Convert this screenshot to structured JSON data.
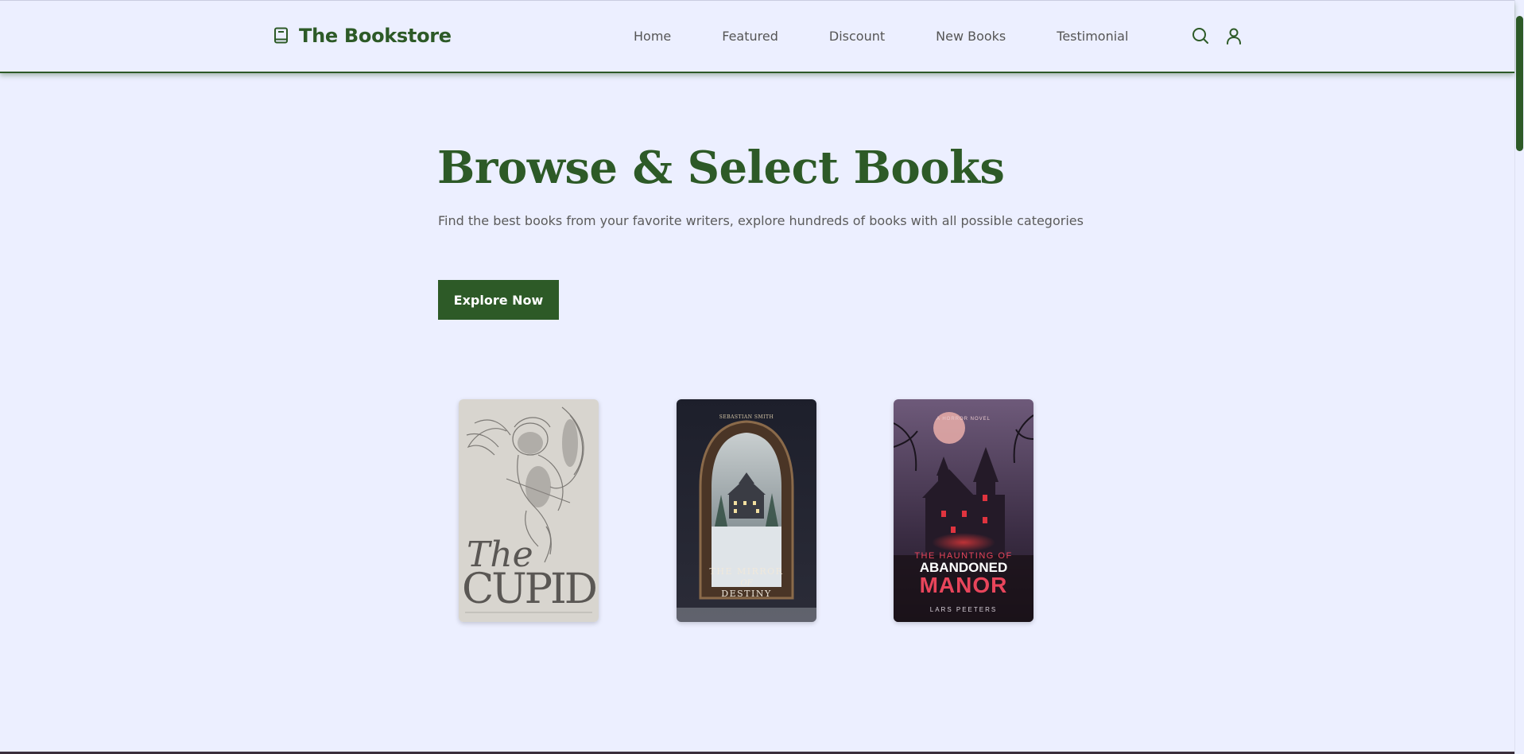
{
  "header": {
    "logo_text": "The Bookstore",
    "nav": [
      {
        "label": "Home"
      },
      {
        "label": "Featured"
      },
      {
        "label": "Discount"
      },
      {
        "label": "New Books"
      },
      {
        "label": "Testimonial"
      }
    ],
    "icons": [
      "book-icon",
      "search-icon",
      "user-icon"
    ]
  },
  "hero": {
    "title": "Browse & Select Books",
    "subtitle": "Find the best books from your favorite writers, explore hundreds of books with all possible categories",
    "cta_label": "Explore Now"
  },
  "books": [
    {
      "title_line1": "The",
      "title_line2": "CUPID"
    },
    {
      "top_text": "SEBASTIAN SMITH",
      "title_line1": "THE MIRROR",
      "title_line2": "OF",
      "title_line3": "DESTINY"
    },
    {
      "top_text": "A HORROR NOVEL",
      "title_line1": "THE HAUNTING OF",
      "title_line2": "ABANDONED",
      "title_line3": "MANOR",
      "author": "LARS PEETERS"
    }
  ],
  "colors": {
    "brand_green": "#2d5a27",
    "background": "#ecefff",
    "text_muted": "#5b5b5b",
    "manor_red": "#e8455b"
  }
}
